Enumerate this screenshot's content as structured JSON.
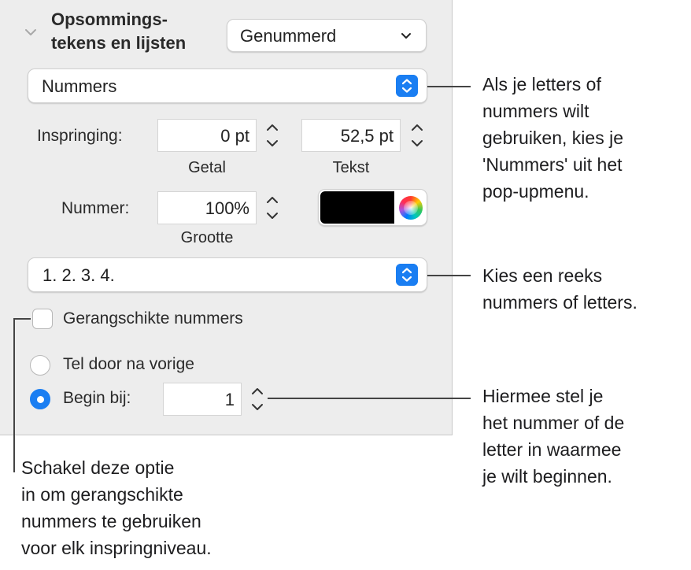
{
  "section": {
    "title_line1": "Opsommings-",
    "title_line2": "tekens en lijsten",
    "style_popup": "Genummerd"
  },
  "type_popup": "Nummers",
  "indent": {
    "label": "Inspringing:",
    "number_value": "0 pt",
    "number_caption": "Getal",
    "text_value": "52,5 pt",
    "text_caption": "Tekst"
  },
  "number": {
    "label": "Nummer:",
    "size_value": "100%",
    "size_caption": "Grootte",
    "color": "#000000"
  },
  "sequence_popup": "1. 2. 3. 4.",
  "tiered": {
    "label": "Gerangschikte nummers",
    "checked": false
  },
  "continue_radio": {
    "label": "Tel door na vorige",
    "selected": false
  },
  "start_radio": {
    "label": "Begin bij:",
    "selected": true,
    "value": "1"
  },
  "callouts": {
    "type": "Als je letters of\nnummers wilt\ngebruiken, kies je\n'Nummers' uit het\npop-upmenu.",
    "sequence": "Kies een reeks\nnummers of letters.",
    "start": "Hiermee stel je\nhet nummer of de\nletter in waarmee\nje wilt beginnen.",
    "tiered": "Schakel deze optie\nin om gerangschikte\nnummers te gebruiken\nvoor elk inspringniveau."
  },
  "colors": {
    "accent": "#1a7ef2",
    "panel": "#ededed"
  }
}
